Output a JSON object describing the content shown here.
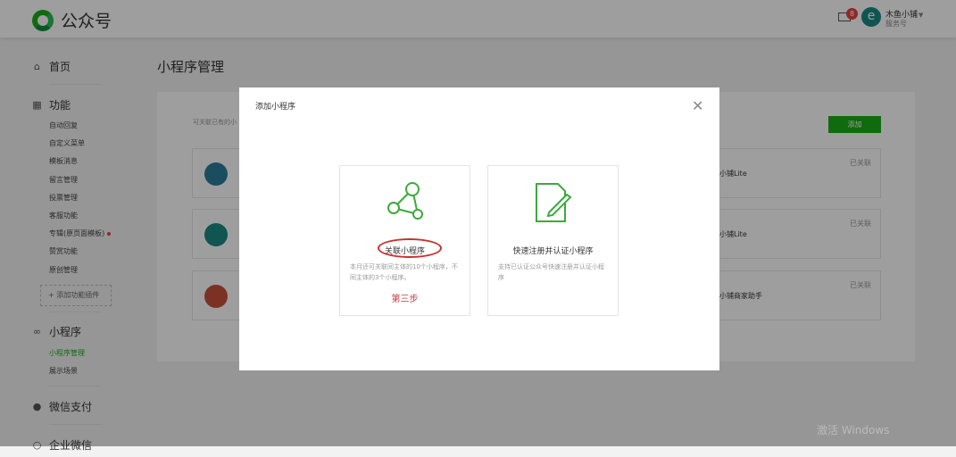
{
  "header": {
    "brand": "公众号",
    "mail_badge": "8",
    "avatar_glyph": "e",
    "account_name": "木鱼小铺",
    "account_type": "服务号"
  },
  "sidebar": {
    "home": "首页",
    "features": {
      "label": "功能",
      "items": [
        "自动回复",
        "自定义菜单",
        "模板消息",
        "留言管理",
        "投票管理",
        "客服功能",
        "专辑(原页面模板)",
        "赞赏功能",
        "原创管理"
      ],
      "add_plugin": "添加功能插件"
    },
    "miniprogram": {
      "label": "小程序",
      "items": [
        "小程序管理",
        "展示场景"
      ]
    },
    "pay": "微信支付",
    "work": "企业微信"
  },
  "main": {
    "title": "小程序管理",
    "hint": "可关联已有的小",
    "add_button": "添加",
    "miniprograms": [
      {
        "name": "小铺Lite",
        "status": "已关联",
        "color": "#2a7d9a"
      },
      {
        "name": "小铺Lite",
        "status": "已关联",
        "color": "#1b8a84"
      },
      {
        "name": "小铺商家助手",
        "status": "已关联",
        "color": "#c9503c"
      }
    ]
  },
  "dialog": {
    "title": "添加小程序",
    "options": [
      {
        "title": "关联小程序",
        "desc": "本月还可关联同主体的10个小程序，不同主体的3个小程序。",
        "annotation": "第三步"
      },
      {
        "title": "快速注册并认证小程序",
        "desc": "支持已认证公众号快速注册并认证小程序"
      }
    ]
  },
  "watermark": "激活 Windows"
}
